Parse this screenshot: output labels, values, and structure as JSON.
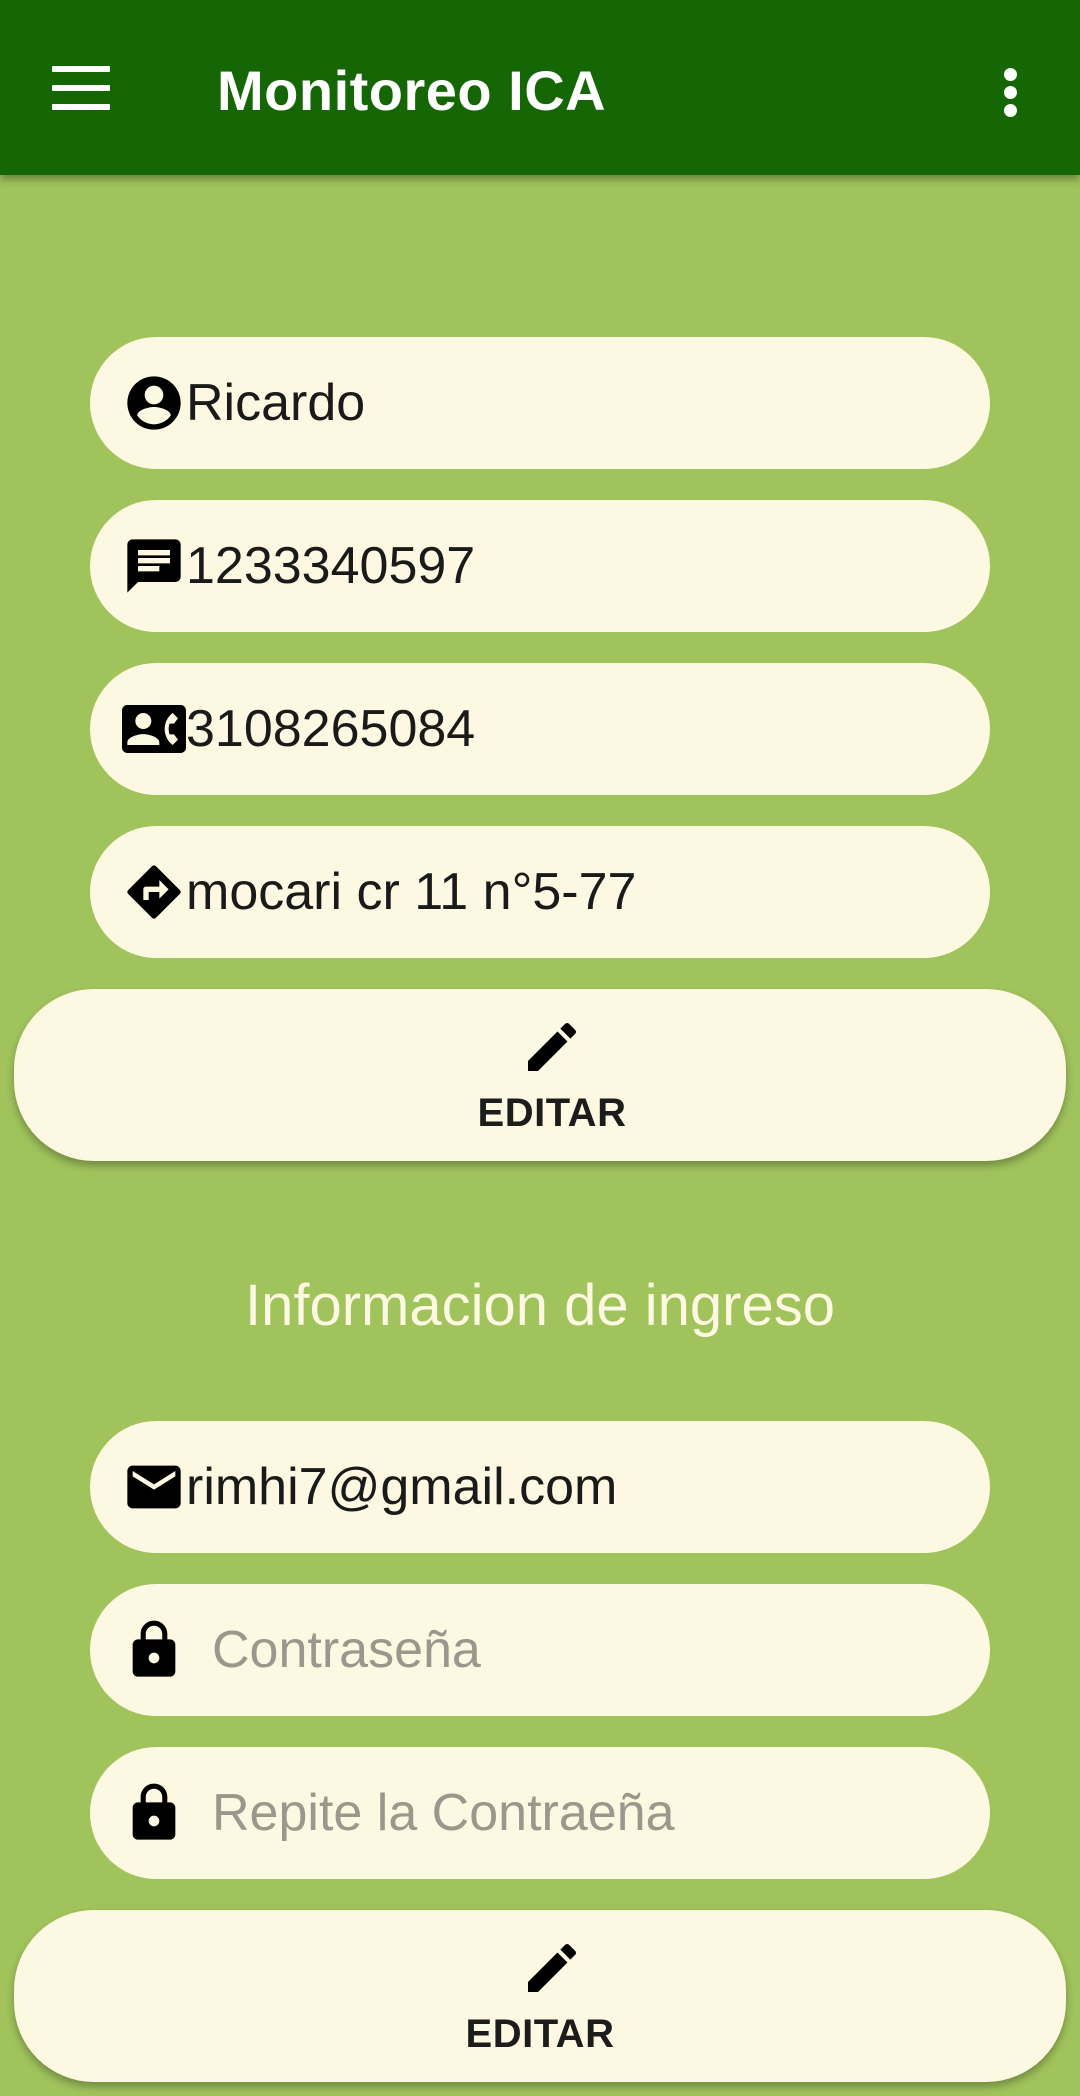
{
  "app_bar": {
    "title": "Monitoreo ICA",
    "menu_icon": "hamburger-menu-icon",
    "overflow_icon": "more-vert-icon",
    "background": "#156604"
  },
  "profile": {
    "name": "Ricardo",
    "document_number": "1233340597",
    "phone": "3108265084",
    "address": "mocari cr 11 n°5-77",
    "edit_label": "EDITAR"
  },
  "login_info": {
    "heading": "Informacion de ingreso",
    "email": "rimhi7@gmail.com",
    "password_placeholder": "Contraseña",
    "repeat_password_placeholder": "Repite la Contraeña",
    "edit_label": "EDITAR"
  },
  "colors": {
    "background": "#a0c35c",
    "field_background": "#fdf8e1",
    "app_bar": "#156604"
  }
}
